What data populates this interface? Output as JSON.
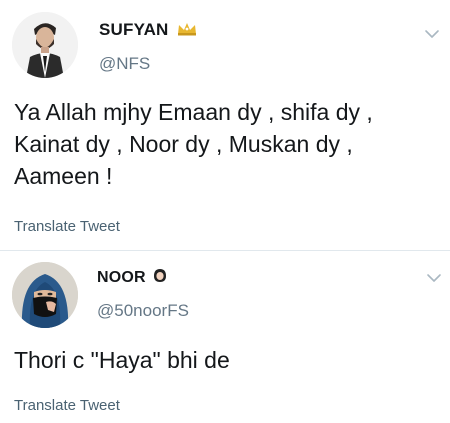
{
  "tweets": [
    {
      "display_name": "SUFYAN",
      "badge_icon": "crown-icon",
      "handle": "@NFS",
      "text": "Ya Allah mjhy Emaan dy , shifa dy , Kainat dy , Noor dy , Muskan dy , Aameen !",
      "translate_label": "Translate Tweet"
    },
    {
      "display_name": "NOOR",
      "badge_icon": "hijab-icon",
      "handle": "@50noorFS",
      "text": "Thori c \"Haya\" bhi de",
      "translate_label": "Translate Tweet"
    }
  ],
  "colors": {
    "text": "#14171a",
    "secondary": "#657786",
    "link": "#4a6272",
    "divider": "#e1e8ed",
    "crown": "#e8b730"
  }
}
